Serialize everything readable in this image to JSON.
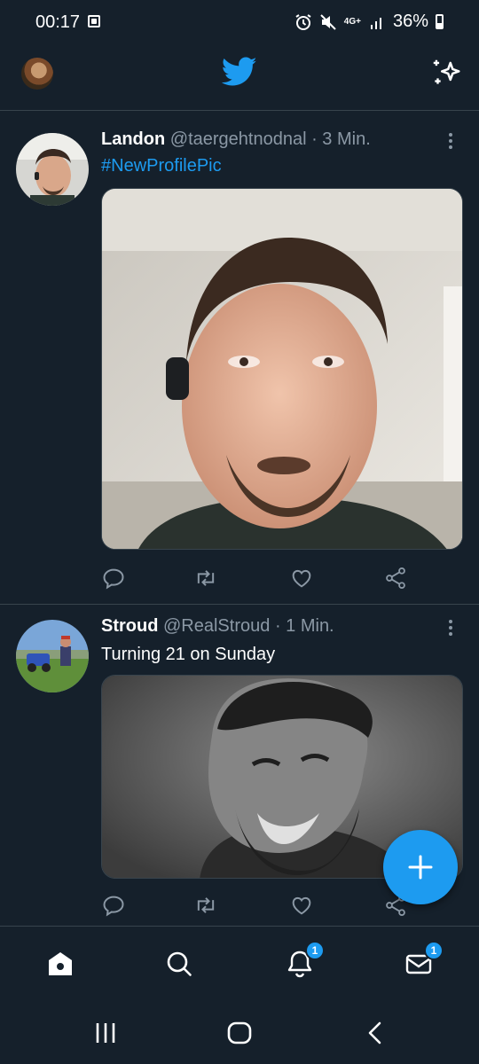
{
  "status_bar": {
    "time": "00:17",
    "network": "4G+",
    "battery": "36%",
    "icons": [
      "gallery-icon",
      "alarm-icon",
      "mute-icon",
      "signal-icon",
      "battery-icon"
    ]
  },
  "header": {
    "logo": "twitter-bird-icon",
    "right_icon": "sparkle-icon",
    "accent_color": "#1d9bf0"
  },
  "tweets": [
    {
      "name": "Landon",
      "handle": "@taergehtnodnal",
      "time": "· 3 Min.",
      "text": "#NewProfilePic",
      "text_is_hashtag": true
    },
    {
      "name": "Stroud",
      "handle": "@RealStroud",
      "time": "· 1 Min.",
      "text": "Turning 21 on Sunday",
      "text_is_hashtag": false
    }
  ],
  "tweet_actions": [
    "reply-icon",
    "retweet-icon",
    "like-icon",
    "share-icon"
  ],
  "bottom_nav": {
    "items": [
      "home-icon",
      "search-icon",
      "notifications-icon",
      "messages-icon"
    ],
    "notifications_badge": "1",
    "messages_badge": "1"
  },
  "system_nav": [
    "recents-icon",
    "home-button-icon",
    "back-icon"
  ]
}
